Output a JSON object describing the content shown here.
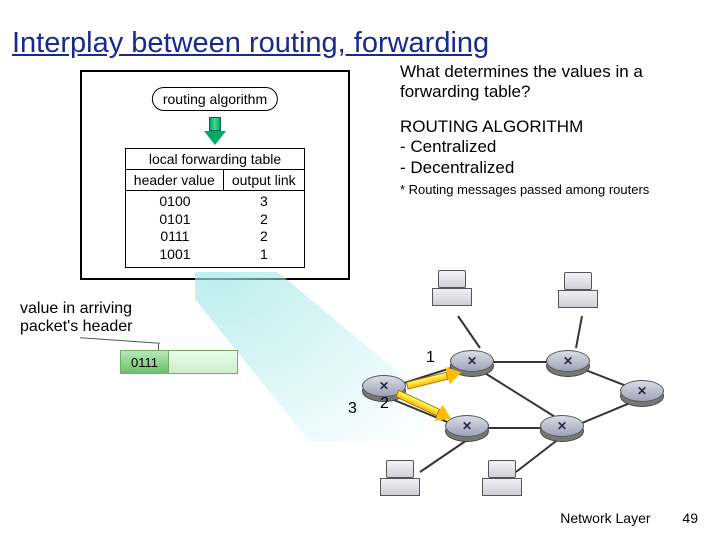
{
  "title": "Interplay between routing, forwarding",
  "algo_box": {
    "label": "routing algorithm",
    "table_caption": "local forwarding table",
    "header_left": "header value",
    "header_right": "output link",
    "rows": [
      {
        "hv": "0100",
        "ol": "3"
      },
      {
        "hv": "0101",
        "ol": "2"
      },
      {
        "hv": "0111",
        "ol": "2"
      },
      {
        "hv": "1001",
        "ol": "1"
      }
    ]
  },
  "right": {
    "question": "What determines the values in a forwarding table?",
    "heading": "ROUTING ALGORITHM",
    "bullet1": "- Centralized",
    "bullet2": "- Decentralized",
    "note": "* Routing messages passed among routers"
  },
  "packet": {
    "label_line1": "value in arriving",
    "label_line2": "packet's header",
    "header_value": "0111"
  },
  "ports": {
    "p1": "1",
    "p2": "2",
    "p3": "3"
  },
  "footer": {
    "section": "Network Layer",
    "page": "49"
  }
}
